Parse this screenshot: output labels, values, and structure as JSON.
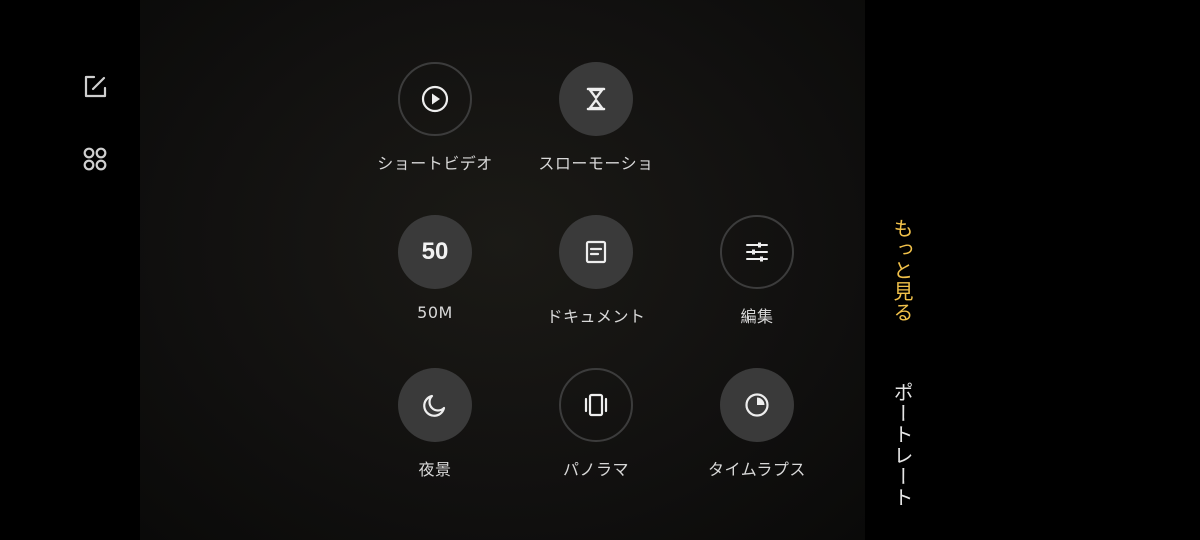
{
  "left_toolbar": {
    "edit_icon": "edit-square-icon",
    "grid_icon": "apps-grid-icon"
  },
  "modes": [
    {
      "id": "short-video",
      "label": "ショートビデオ",
      "icon": "play-circle-icon",
      "style": "outline"
    },
    {
      "id": "slow-motion",
      "label": "スローモーショ",
      "icon": "hourglass-icon",
      "style": "filled"
    },
    {
      "id": "50m",
      "label": "50M",
      "badge": "50",
      "style": "filled"
    },
    {
      "id": "document",
      "label": "ドキュメント",
      "icon": "document-icon",
      "style": "filled"
    },
    {
      "id": "edit",
      "label": "編集",
      "icon": "sliders-icon",
      "style": "outline"
    },
    {
      "id": "night",
      "label": "夜景",
      "icon": "moon-icon",
      "style": "filled"
    },
    {
      "id": "panorama",
      "label": "パノラマ",
      "icon": "panorama-icon",
      "style": "outline"
    },
    {
      "id": "timelapse",
      "label": "タイムラプス",
      "icon": "timer-pie-icon",
      "style": "filled"
    }
  ],
  "side_tabs": {
    "more": "もっと見る",
    "portrait": "ポートレート"
  },
  "colors": {
    "accent": "#f1c14a",
    "text": "#d8d8d8",
    "button_fill": "#3a3a3a"
  }
}
